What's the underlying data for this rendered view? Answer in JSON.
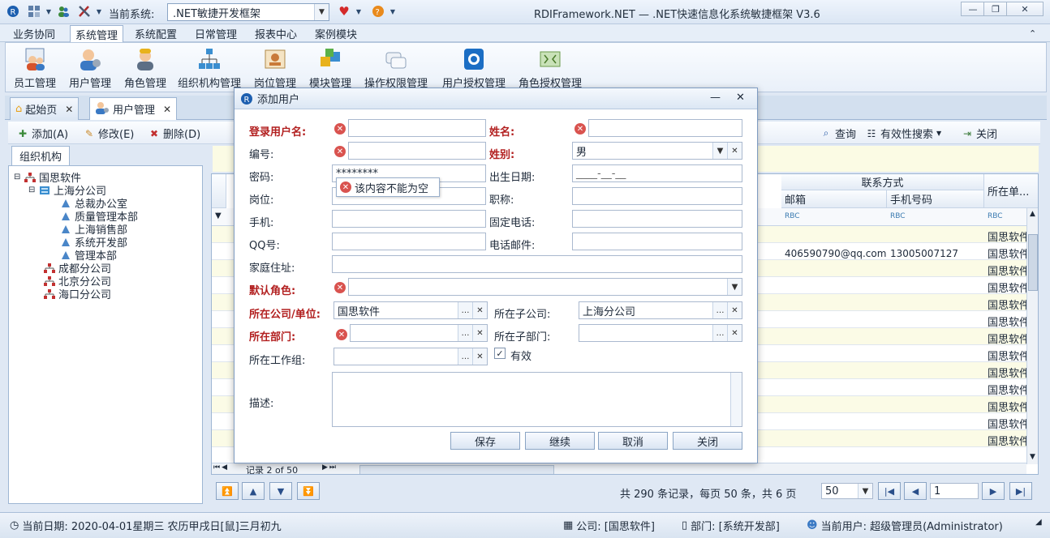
{
  "titlebar": {
    "system_label": "当前系统:",
    "system_value": ".NET敏捷开发框架",
    "app_title": "RDIFramework.NET — .NET快速信息化系统敏捷框架 V3.6",
    "minimize": "—",
    "restore": "❐",
    "close": "✕"
  },
  "menu": {
    "items": [
      "业务协同",
      "系统管理",
      "系统配置",
      "日常管理",
      "报表中心",
      "案例模块"
    ],
    "active": "系统管理",
    "collapse": "⌃"
  },
  "ribbon": {
    "buttons": [
      {
        "label": "员工管理",
        "icon": "staff-icon"
      },
      {
        "label": "用户管理",
        "icon": "user-icon"
      },
      {
        "label": "角色管理",
        "icon": "role-icon"
      },
      {
        "label": "组织机构管理",
        "icon": "org-icon"
      },
      {
        "label": "岗位管理",
        "icon": "post-icon"
      },
      {
        "label": "模块管理",
        "icon": "module-icon"
      },
      {
        "label": "操作权限管理",
        "icon": "permission-icon"
      },
      {
        "label": "用户授权管理",
        "icon": "user-auth-icon"
      },
      {
        "label": "角色授权管理",
        "icon": "role-auth-icon"
      }
    ]
  },
  "tabs": [
    {
      "label": "起始页",
      "close": "✕"
    },
    {
      "label": "用户管理",
      "close": "✕"
    }
  ],
  "toolbar": {
    "add": "添加(A)",
    "edit": "修改(E)",
    "delete": "删除(D)",
    "query": "查询",
    "valid_search": "有效性搜索",
    "close": "关闭"
  },
  "left_panel": {
    "tab": "组织机构",
    "tree": [
      {
        "label": "国思软件",
        "level": 0
      },
      {
        "label": "上海分公司",
        "level": 1
      },
      {
        "label": "总裁办公室",
        "level": 2
      },
      {
        "label": "质量管理本部",
        "level": 2
      },
      {
        "label": "上海销售部",
        "level": 2
      },
      {
        "label": "系统开发部",
        "level": 2
      },
      {
        "label": "管理本部",
        "level": 2
      },
      {
        "label": "成都分公司",
        "level": 1
      },
      {
        "label": "北京分公司",
        "level": 1
      },
      {
        "label": "海口分公司",
        "level": 1
      }
    ]
  },
  "grid": {
    "group_header": "联系方式",
    "columns": [
      "邮箱",
      "手机号码",
      "所在单..."
    ],
    "filter_tag": "RBC",
    "row": {
      "email": "406590790@qq.com",
      "mobile": "13005007127"
    },
    "company_cells": [
      "国思软件",
      "国思软件",
      "国思软件",
      "国思软件",
      "国思软件",
      "国思软件",
      "国思软件",
      "国思软件",
      "国思软件",
      "国思软件",
      "国思软件",
      "国思软件",
      "国思软件",
      "国思软件",
      "国思软件"
    ],
    "record_nav": "记录 2 of 50"
  },
  "pager": {
    "summary": "共 290 条记录，每页 50 条，共 6 页",
    "page_size": "50",
    "page_number": "1"
  },
  "statusbar": {
    "date": "当前日期: 2020-04-01星期三 农历甲戌日[鼠]三月初九",
    "company": "公司: [国思软件]",
    "department": "部门: [系统开发部]",
    "current_user": "当前用户: 超级管理员(Administrator)"
  },
  "dialog": {
    "title": "添加用户",
    "labels": {
      "login_name": "登录用户名:",
      "real_name": "姓名:",
      "code": "编号:",
      "gender": "姓别:",
      "password": "密码:",
      "birthday": "出生日期:",
      "post": "岗位:",
      "title": "职称:",
      "mobile": "手机:",
      "telephone": "固定电话:",
      "qq": "QQ号:",
      "email": "电话邮件:",
      "address": "家庭住址:",
      "default_role": "默认角色:",
      "company": "所在公司/单位:",
      "sub_company": "所在子公司:",
      "department": "所在部门:",
      "sub_department": "所在子部门:",
      "workgroup": "所在工作组:",
      "enabled": "有效",
      "description": "描述:"
    },
    "values": {
      "gender": "男",
      "password": "********",
      "birthday": "____-__-__",
      "company": "国思软件",
      "sub_company": "上海分公司"
    },
    "tooltip": "该内容不能为空",
    "buttons": {
      "save": "保存",
      "continue": "继续",
      "cancel": "取消",
      "close": "关闭"
    },
    "min": "—",
    "close_x": "✕"
  }
}
